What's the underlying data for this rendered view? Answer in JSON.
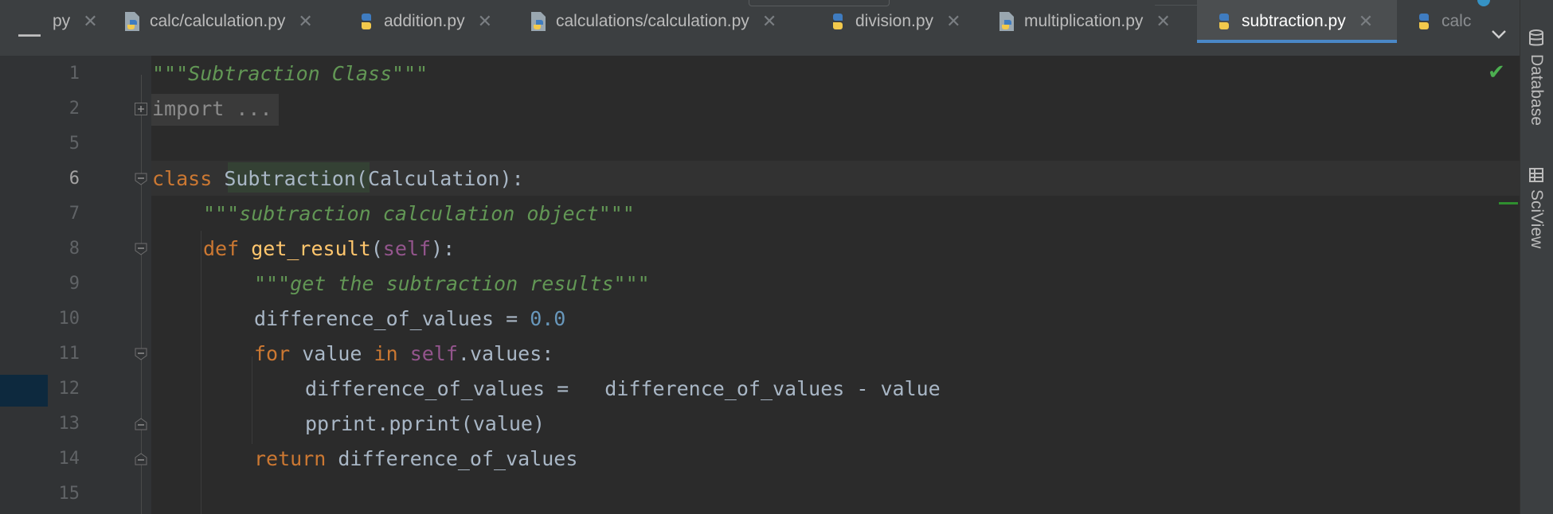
{
  "tabs": [
    {
      "label": "py",
      "active": false
    },
    {
      "label": "calc/calculation.py",
      "active": false
    },
    {
      "label": "addition.py",
      "active": false
    },
    {
      "label": "calculations/calculation.py",
      "active": false
    },
    {
      "label": "division.py",
      "active": false
    },
    {
      "label": "multiplication.py",
      "active": false
    },
    {
      "label": "subtraction.py",
      "active": true
    },
    {
      "label": "calc",
      "active": false
    }
  ],
  "close_glyph": "✕",
  "line_numbers": [
    "1",
    "2",
    "5",
    "6",
    "7",
    "8",
    "9",
    "10",
    "11",
    "12",
    "13",
    "14",
    "15"
  ],
  "current_line": "6",
  "code": {
    "l1_doc": "\"\"\"Subtraction Class\"\"\"",
    "l2_import": "import ...",
    "l6_kw": "class",
    "l6_name": "Subtraction",
    "l6_rest": "(Calculation):",
    "l7_doc": "\"\"\"subtraction calculation object\"\"\"",
    "l8_kw": "def",
    "l8_fn": "get_result",
    "l8_open": "(",
    "l8_self": "self",
    "l8_close": "):",
    "l9_doc": "\"\"\"get the subtraction results\"\"\"",
    "l10_var": "difference_of_values = ",
    "l10_num": "0.0",
    "l11_for": "for",
    "l11_value": " value ",
    "l11_in": "in",
    "l11_self": "self",
    "l11_rest": ".values:",
    "l12": "difference_of_values =   difference_of_values - value",
    "l13": "pprint.pprint(value)",
    "l14_kw": "return",
    "l14_rest": " difference_of_values"
  },
  "tool_windows": {
    "database": "Database",
    "sciview": "SciView"
  },
  "colors": {
    "keyword": "#cc7832",
    "docstring": "#629755",
    "self": "#94558d",
    "function": "#ffc66d",
    "number": "#6897bb",
    "tab_accent": "#4a88c7"
  }
}
